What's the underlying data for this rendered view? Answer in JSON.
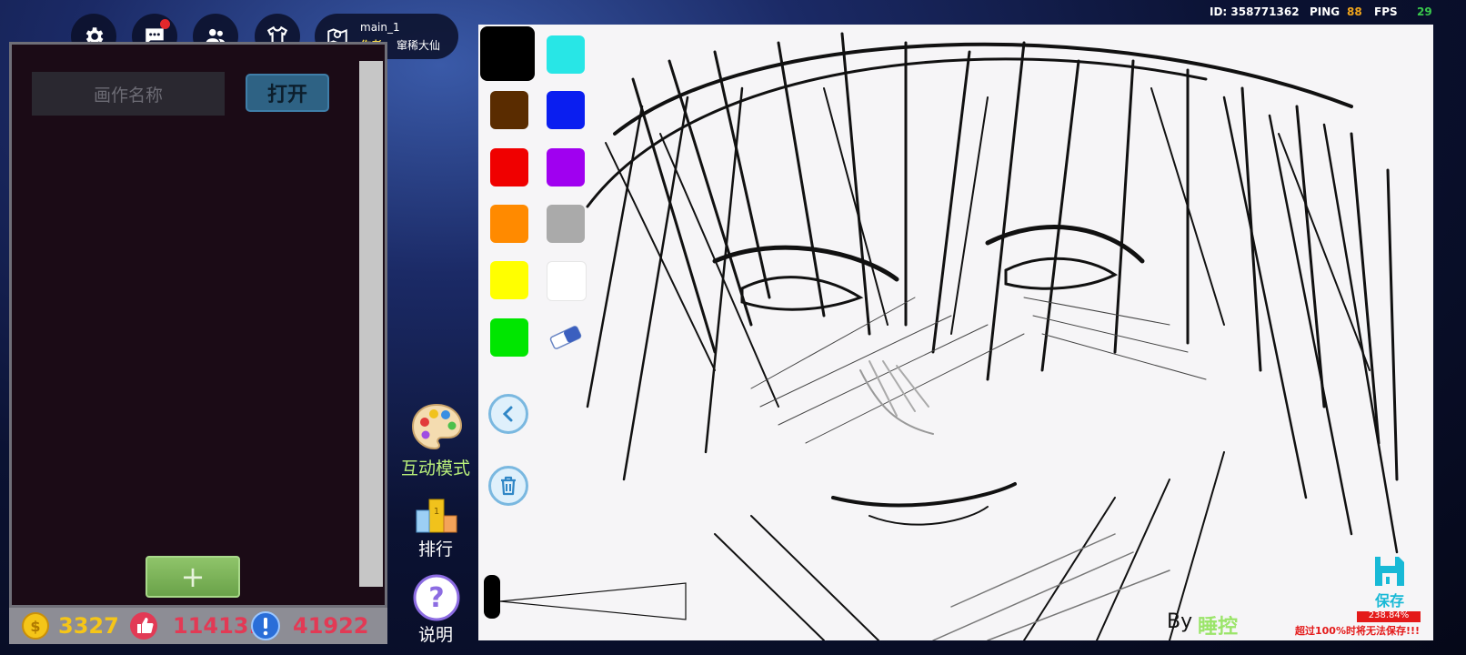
{
  "header": {
    "map_name": "main_1",
    "author_label": "作者:",
    "author_name": "窜稀大仙",
    "id_text": "ID: 358771362",
    "ping_label": "PING",
    "ping_value": "88",
    "fps_label": "FPS",
    "fps_value": "29"
  },
  "left_panel": {
    "name_placeholder": "画作名称",
    "open_label": "打开",
    "add_label": "+"
  },
  "currency": {
    "coins": "3327",
    "likes": "11413.8",
    "points": "41922"
  },
  "tools": {
    "interactive_mode": "互动模式",
    "ranking": "排行",
    "help": "说明"
  },
  "canvas": {
    "palette": [
      "#000000",
      "#28e6e6",
      "#5a2c00",
      "#0a1ef0",
      "#f00000",
      "#a000f0",
      "#ff8a00",
      "#aaaaaa",
      "#ffff00",
      "#ffffff",
      "#00e600"
    ],
    "signature_prefix": "By",
    "signature_name": "睡控",
    "save_label": "保存",
    "percent_text": "238.84%",
    "percent_value": 238.84,
    "warning": "超过100%时将无法保存!!!"
  },
  "colors": {
    "gold": "#f5c518",
    "likes_red": "#e23a55",
    "points_blue": "#2a6ed8",
    "ping_orange": "#f1a51c",
    "fps_green": "#39c84c",
    "author_yellow": "#f5d94a"
  }
}
